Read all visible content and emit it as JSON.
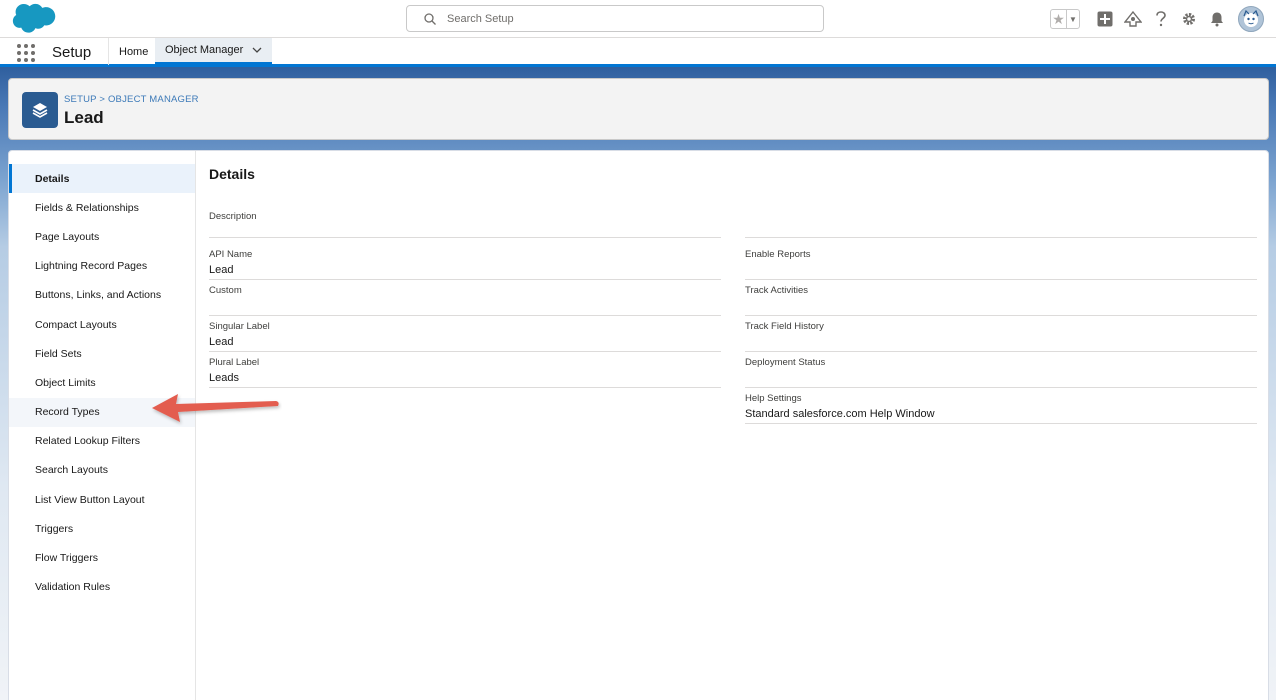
{
  "header": {
    "search_placeholder": "Search Setup"
  },
  "context_bar": {
    "app_name": "Setup",
    "tabs": [
      {
        "label": "Home"
      },
      {
        "label": "Object Manager"
      }
    ]
  },
  "page_header": {
    "breadcrumb_setup": "SETUP",
    "breadcrumb_sep": ">",
    "breadcrumb_om": "OBJECT MANAGER",
    "title": "Lead"
  },
  "sidebar": {
    "items": [
      {
        "label": "Details"
      },
      {
        "label": "Fields & Relationships"
      },
      {
        "label": "Page Layouts"
      },
      {
        "label": "Lightning Record Pages"
      },
      {
        "label": "Buttons, Links, and Actions"
      },
      {
        "label": "Compact Layouts"
      },
      {
        "label": "Field Sets"
      },
      {
        "label": "Object Limits"
      },
      {
        "label": "Record Types"
      },
      {
        "label": "Related Lookup Filters"
      },
      {
        "label": "Search Layouts"
      },
      {
        "label": "List View Button Layout"
      },
      {
        "label": "Triggers"
      },
      {
        "label": "Flow Triggers"
      },
      {
        "label": "Validation Rules"
      }
    ]
  },
  "details": {
    "title": "Details",
    "left_fields": [
      {
        "label": "Description",
        "value": ""
      },
      {
        "label": "API Name",
        "value": "Lead"
      },
      {
        "label": "Custom",
        "value": ""
      },
      {
        "label": "Singular Label",
        "value": "Lead"
      },
      {
        "label": "Plural Label",
        "value": "Leads"
      }
    ],
    "right_fields": [
      {
        "label": "",
        "value": ""
      },
      {
        "label": "Enable Reports",
        "value": ""
      },
      {
        "label": "Track Activities",
        "value": ""
      },
      {
        "label": "Track Field History",
        "value": ""
      },
      {
        "label": "Deployment Status",
        "value": ""
      },
      {
        "label": "Help Settings",
        "value": "Standard salesforce.com Help Window"
      }
    ]
  },
  "colors": {
    "brand_blue": "#0176d3",
    "object_icon": "#2a5b91",
    "annotation_arrow": "#e35d4f"
  }
}
